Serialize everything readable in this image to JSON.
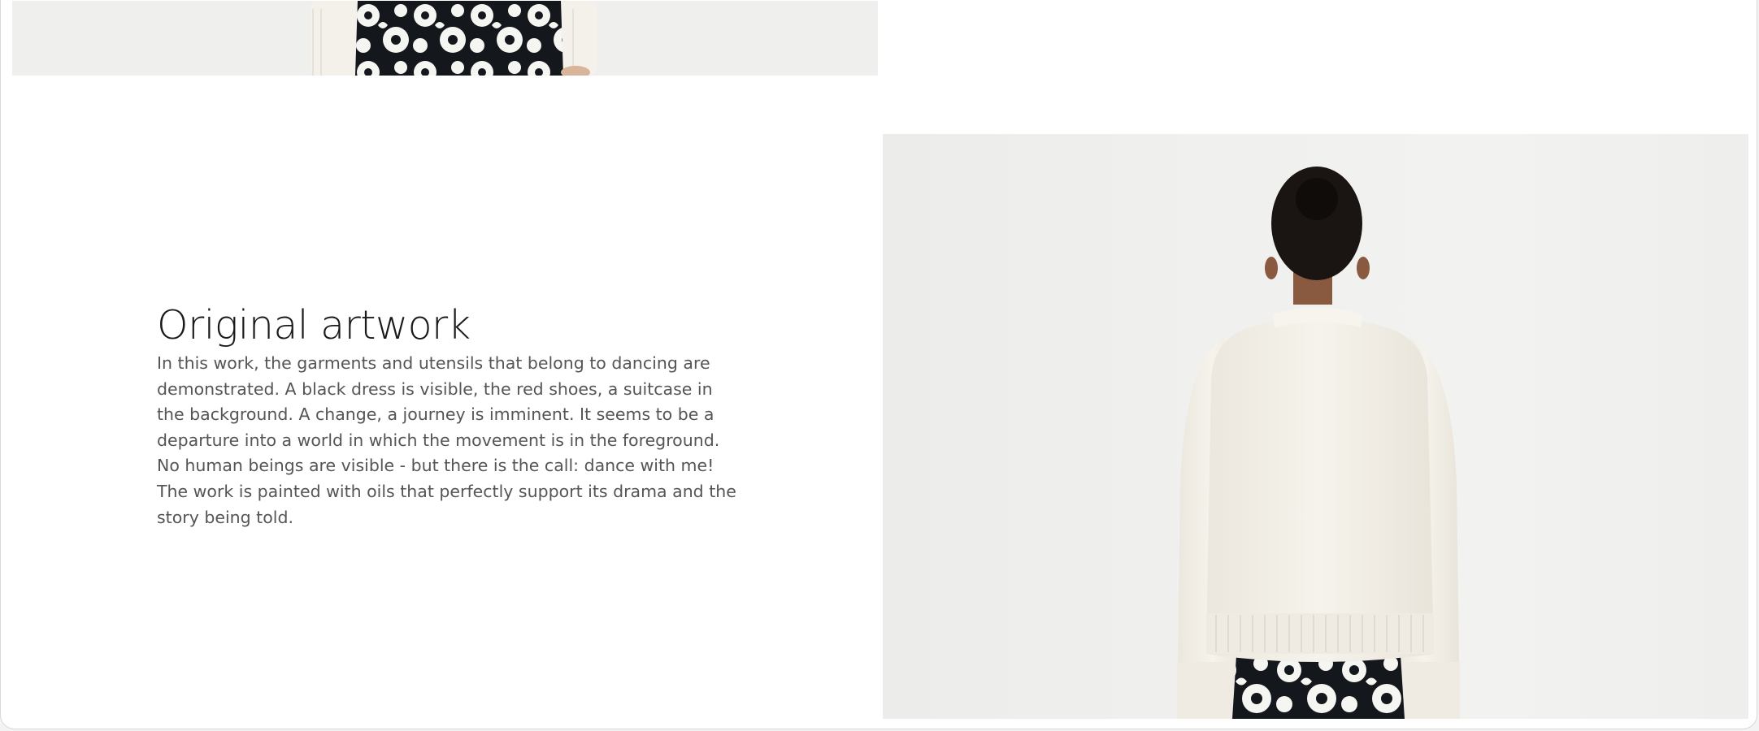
{
  "section": {
    "title": "Original artwork",
    "description": "In this work, the garments and utensils that belong to dancing are demonstrated. A black dress is visible, the red shoes, a suitcase in the background. A change, a journey is imminent. It seems to be a departure into a world in which the movement is in the foreground. No human beings are visible - but there is the call: dance with me! The work is painted with oils that perfectly support its drama and the story being told."
  },
  "images": {
    "top": {
      "label": "model-front-cropped",
      "alt": "Model in white knit sweater and black floral skirt, front view (cropped)"
    },
    "main": {
      "label": "model-back-view",
      "alt": "Model in white knit sweater and black floral skirt, back view"
    }
  },
  "colors": {
    "background": "#ffffff",
    "photo_backdrop": "#efefed",
    "sweater": "#f4f1ea",
    "skirt": "#111418",
    "title_text": "#1a1a1a",
    "body_text": "#555555"
  }
}
